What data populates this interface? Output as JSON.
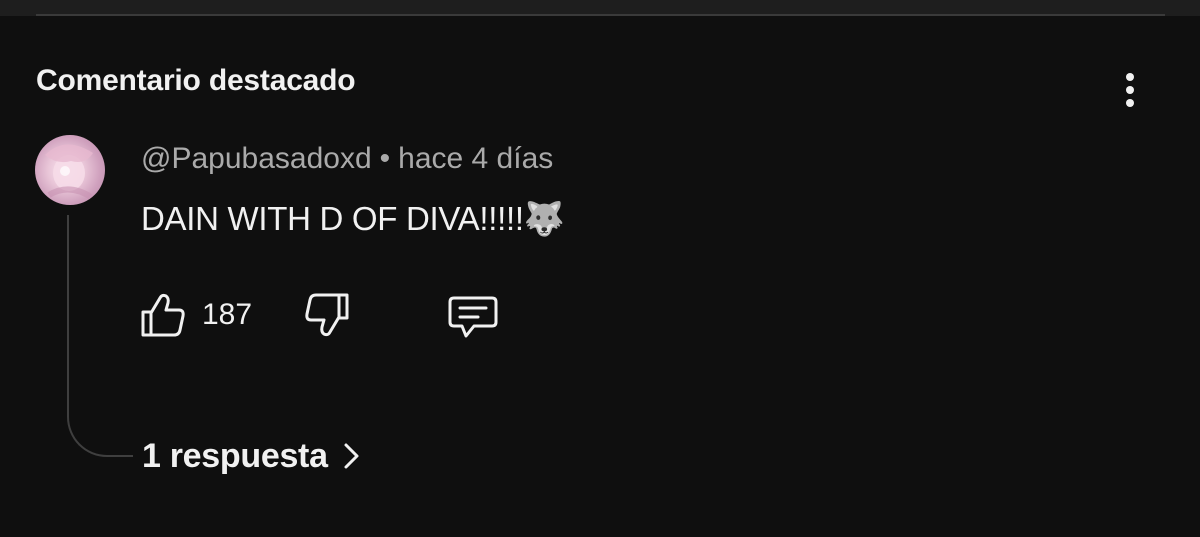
{
  "section": {
    "title": "Comentario destacado"
  },
  "comment": {
    "author": "@Papubasadoxd",
    "separator": "•",
    "time": "hace 4 días",
    "text": "DAIN WITH D OF DIVA!!!!!🐺",
    "likes": "187"
  },
  "icons": {
    "more": "more-vertical-icon",
    "like": "thumbs-up-icon",
    "dislike": "thumbs-down-icon",
    "reply": "comment-icon",
    "chevron": "chevron-right-icon"
  },
  "replies": {
    "label": "1 respuesta"
  }
}
